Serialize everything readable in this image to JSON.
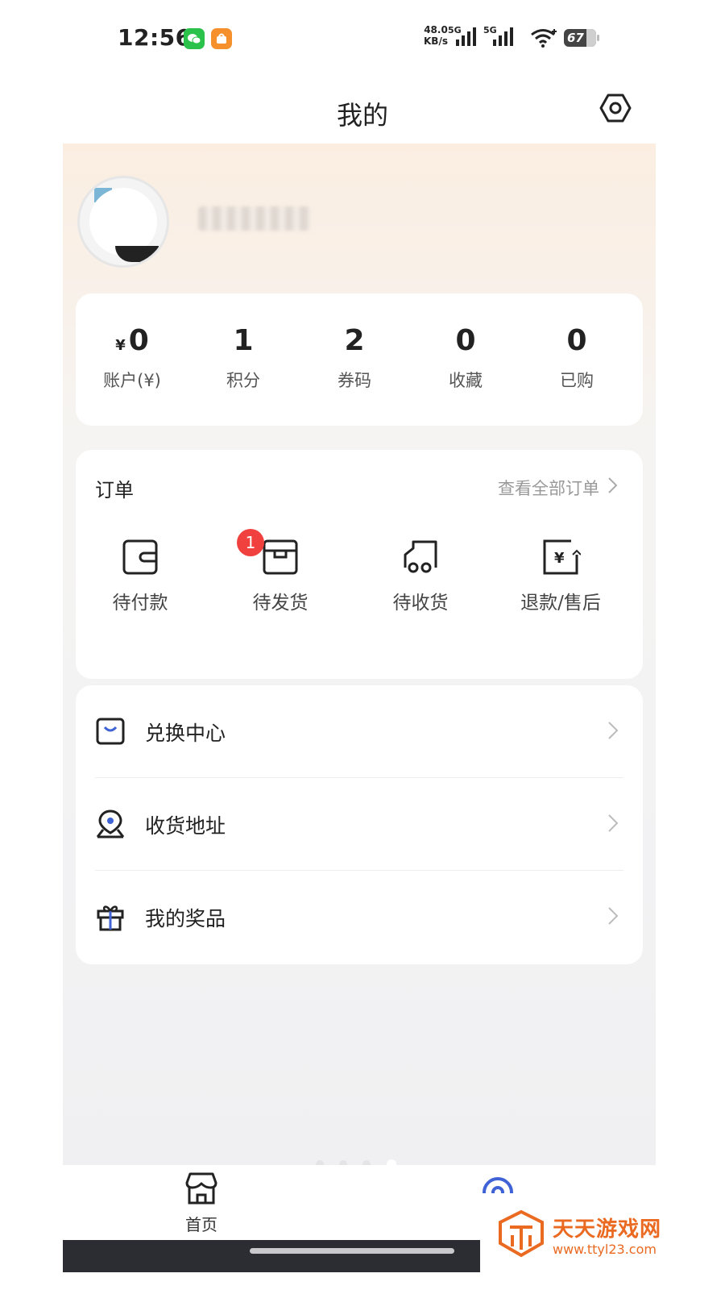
{
  "status_bar": {
    "time": "12:56",
    "net_speed_value": "48.0",
    "net_speed_unit": "KB/s",
    "sim1_label": "5G",
    "sim2_label": "5G",
    "battery": "67"
  },
  "header": {
    "title": "我的"
  },
  "profile": {
    "avatar": "avatar-image",
    "username": ""
  },
  "stats": [
    {
      "currency": "¥",
      "value": "0",
      "label": "账户(¥)"
    },
    {
      "value": "1",
      "label": "积分"
    },
    {
      "value": "2",
      "label": "券码"
    },
    {
      "value": "0",
      "label": "收藏"
    },
    {
      "value": "0",
      "label": "已购"
    }
  ],
  "orders": {
    "title": "订单",
    "view_all": "查看全部订单",
    "items": [
      {
        "label": "待付款",
        "icon": "wallet-icon"
      },
      {
        "label": "待发货",
        "icon": "box-icon",
        "badge": "1"
      },
      {
        "label": "待收货",
        "icon": "truck-icon"
      },
      {
        "label": "退款/售后",
        "icon": "refund-icon"
      }
    ]
  },
  "menu": [
    {
      "label": "兑换中心",
      "icon": "shopping-bag-icon"
    },
    {
      "label": "收货地址",
      "icon": "location-icon"
    },
    {
      "label": "我的奖品",
      "icon": "gift-icon"
    }
  ],
  "bottom_nav": {
    "home_label": "首页"
  },
  "watermark": {
    "title": "天天游戏网",
    "url": "www.ttyl23.com"
  },
  "colors": {
    "badge": "#f0413f",
    "accent_blue": "#3f63d6",
    "watermark_orange": "#ea6a22"
  }
}
